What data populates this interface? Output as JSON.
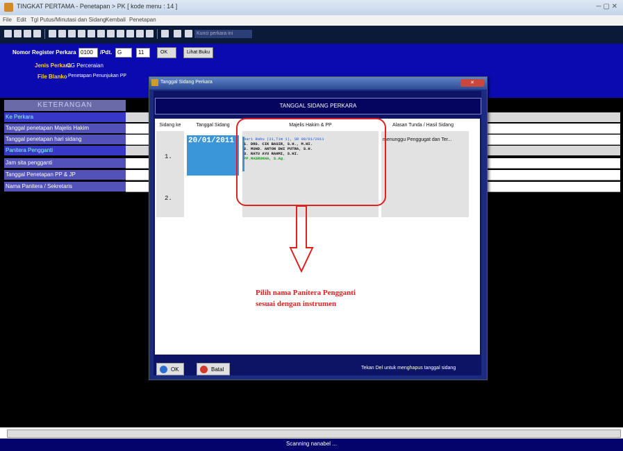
{
  "window": {
    "title": "TINGKAT PERTAMA - Penetapan > PK  [ kode menu : 14 ]",
    "controls": "─ ▢ ✕"
  },
  "menu": [
    "File",
    "Edit",
    "Tgl Putus/Minutasi dan Sidang",
    "Kembali",
    "Penetapan"
  ],
  "toolbar": {
    "search_placeholder": "Kunci perkara ini"
  },
  "header": {
    "nomor_label": "Nomor Register Perkara",
    "nomor_value": "0100",
    "pdt_label": "/Pdt.",
    "pdt_value": "G",
    "pdt_code": "11",
    "ok_label": "OK",
    "lihat_label": "Lihat Buku",
    "jenis_label": "Jenis Perkara",
    "jenis_value": "CG Perceraian",
    "file_label": "File Blanko",
    "file_value": "Penetapan Penunjukan PP"
  },
  "keterangan": {
    "header": "KETERANGAN",
    "rows": [
      {
        "label": "Ke Perkara",
        "section": true
      },
      {
        "label": "Tanggal penetapan Majelis Hakim",
        "section": false
      },
      {
        "label": "Tanggal penetapan hari sidang",
        "section": false
      },
      {
        "label": "Panitera Pengganti",
        "section": true
      },
      {
        "label": "Jam sita pengganti",
        "section": false
      },
      {
        "label": "Tanggal Penetapan PP & JP",
        "section": false
      },
      {
        "label": "Nama Panitera / Sekretaris",
        "section": false
      }
    ]
  },
  "dialog": {
    "title": "Tanggal Sidang Perkara",
    "close": "✕",
    "heading": "TANGGAL SIDANG PERKARA",
    "columns": [
      "Sidang ke",
      "Tanggal Sidang",
      "Majelis Hakim & PP",
      "Alasan Tunda / Hasil Sidang"
    ],
    "rows": [
      {
        "no": "1.",
        "date": "20/01/2011",
        "majelis": [
          {
            "text": "Hari Rabu (31,Tim 1), SR 08/01/2011",
            "color": "#1a57d6"
          },
          {
            "text": "1. DRS. CIK BASIR, S.H., M.HI.",
            "color": "#111111"
          },
          {
            "text": "2. MUHD. ANTON DWI PUTRA, S.H.",
            "color": "#111111"
          },
          {
            "text": "3. RATU AYU RAHMI, S.HI.",
            "color": "#111111"
          },
          {
            "text": "PP.MASRUKHA, S.Ag.",
            "color": "#1a9a1a"
          }
        ],
        "alasan": "menunggu Penggugat dan Ter..."
      },
      {
        "no": "2.",
        "date": "",
        "majelis": [],
        "alasan": ""
      }
    ],
    "ok_label": "OK",
    "batal_label": "Batal",
    "hint": "Tekan Del untuk menghapus tanggal sidang"
  },
  "annotation": {
    "line1": "Pilih nama Panitera Pengganti",
    "line2": "sesuai dengan instrumen"
  },
  "status": {
    "text": "Scanning nanabel ..."
  }
}
